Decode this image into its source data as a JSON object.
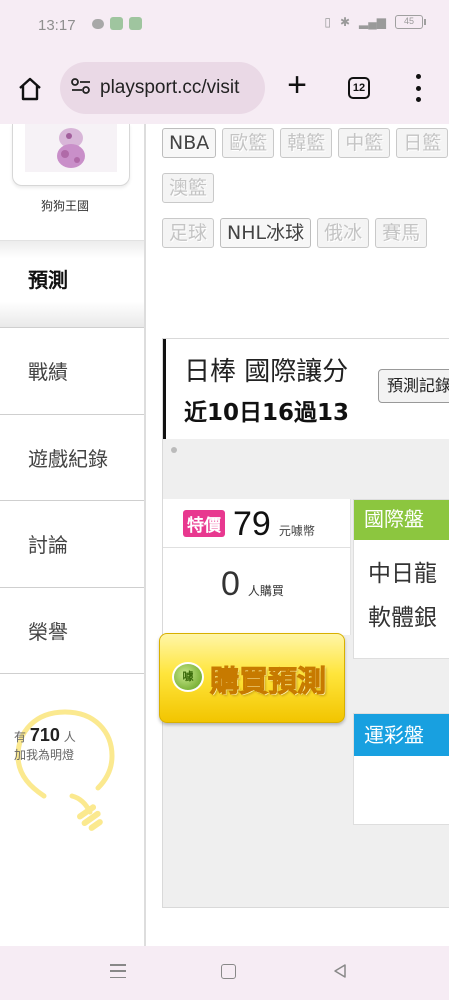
{
  "status_bar": {
    "time": "13:17",
    "battery": "45"
  },
  "browser": {
    "url": "playsport.cc/visit",
    "tab_count": "12"
  },
  "sidebar": {
    "profile_name": "狗狗王國",
    "items": [
      {
        "label": "預測",
        "active": true
      },
      {
        "label": "戰績",
        "active": false
      },
      {
        "label": "遊戲紀錄",
        "active": false
      },
      {
        "label": "討論",
        "active": false
      },
      {
        "label": "榮譽",
        "active": false
      }
    ],
    "lamp": {
      "prefix": "有",
      "count": "710",
      "suffix": "人",
      "line2": "加我為明燈"
    }
  },
  "league_tags": {
    "row1": [
      "NBA",
      "歐籃",
      "韓籃",
      "中籃",
      "日籃"
    ],
    "row2": [
      "澳籃"
    ],
    "row3": [
      "足球",
      "NHL冰球",
      "俄冰",
      "賽馬"
    ],
    "active": [
      "NBA",
      "NHL冰球"
    ]
  },
  "prediction_panel": {
    "title": "日棒 國際讓分",
    "record": "近10日16過13",
    "record_button": "預測記錄",
    "special_badge": "特價",
    "price": "79",
    "price_unit": "元噱幣",
    "buyers": "0",
    "buyers_unit": "人購買",
    "buy_button": "購買預測",
    "buy_logo": "噱",
    "intl_header": "國際盤",
    "intl_line1": "中日龍",
    "intl_line2": "軟體銀",
    "lottery_header": "運彩盤"
  },
  "colors": {
    "system_bar": "#f6ecf4",
    "special_badge": "#e8388f",
    "intl_header": "#8cc63f",
    "lottery_header": "#18a0e0",
    "buy_button": "#ffe53c"
  },
  "icons": [
    "home-icon",
    "site-settings-icon",
    "plus-icon",
    "tabs-icon",
    "more-menu-icon",
    "recents-icon",
    "home-nav-icon",
    "back-icon",
    "lightbulb-icon"
  ]
}
